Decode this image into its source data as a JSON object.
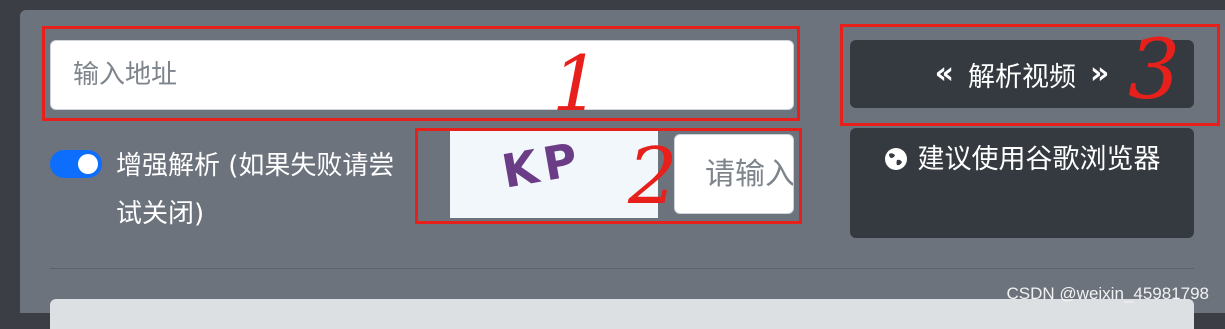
{
  "form": {
    "address_placeholder": "输入地址",
    "parse_button_label": "解析视频",
    "parse_button_left_icon": "double-chevron-left",
    "parse_button_right_icon": "double-chevron-right",
    "toggle_label": "增强解析 (如果失败请尝试关闭)",
    "toggle_checked": true,
    "captcha_text": "KP",
    "captcha_placeholder": "请输入验证码",
    "browser_button_label": "建议使用谷歌浏览器",
    "browser_button_icon": "globe-icon"
  },
  "annotations": {
    "marks": [
      "1",
      "2",
      "3"
    ],
    "color": "#e8201c"
  },
  "watermark": "CSDN @weixin_45981798",
  "colors": {
    "panel": "#6c737c",
    "button": "#343a40",
    "toggle": "#0d6efd"
  }
}
